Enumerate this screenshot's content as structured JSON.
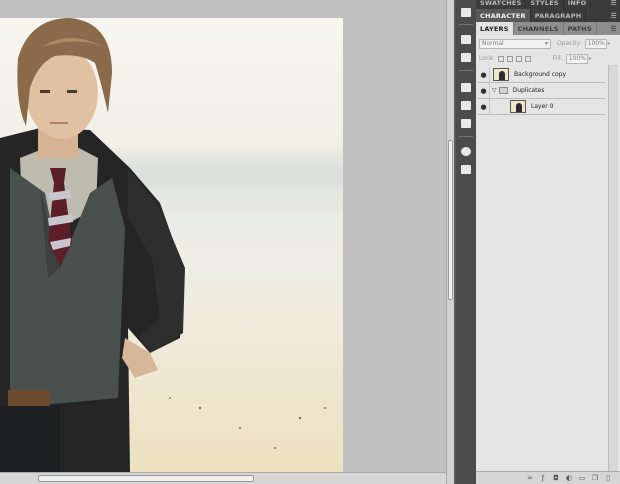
{
  "panel_groups": {
    "top_tabs": [
      {
        "label": "SWATCHES",
        "active": false
      },
      {
        "label": "STYLES",
        "active": false
      },
      {
        "label": "INFO",
        "active": false
      }
    ],
    "type_tabs": [
      {
        "label": "CHARACTER",
        "active": true
      },
      {
        "label": "PARAGRAPH",
        "active": false
      }
    ]
  },
  "layers_panel": {
    "tabs": [
      {
        "label": "LAYERS",
        "active": true
      },
      {
        "label": "CHANNELS",
        "active": false
      },
      {
        "label": "PATHS",
        "active": false
      }
    ],
    "blend_mode": "Normal",
    "opacity_label": "Opacity:",
    "opacity_value": "100%",
    "lock_label": "Lock:",
    "fill_label": "Fill:",
    "fill_value": "100%",
    "layers": [
      {
        "name": "Background copy",
        "type": "image"
      },
      {
        "name": "Duplicates",
        "type": "group"
      },
      {
        "name": "Layer 0",
        "type": "image"
      }
    ],
    "bottom_icons": [
      "link-icon",
      "fx-icon",
      "mask-icon",
      "adjustment-icon",
      "folder-icon",
      "new-layer-icon",
      "trash-icon"
    ]
  },
  "icon_strip": [
    "histogram-icon",
    "navigator-icon",
    "tools-icon",
    "brush-icon",
    "clone-icon",
    "adjustments-icon",
    "masks-icon",
    "3d-icon"
  ],
  "colors": {
    "canvas_bg": "#c0c0c0",
    "panel_dark": "#525252",
    "panel_light": "#e5e5e5",
    "photo_sky": "#f3f1e6",
    "jacket": "#262626"
  }
}
